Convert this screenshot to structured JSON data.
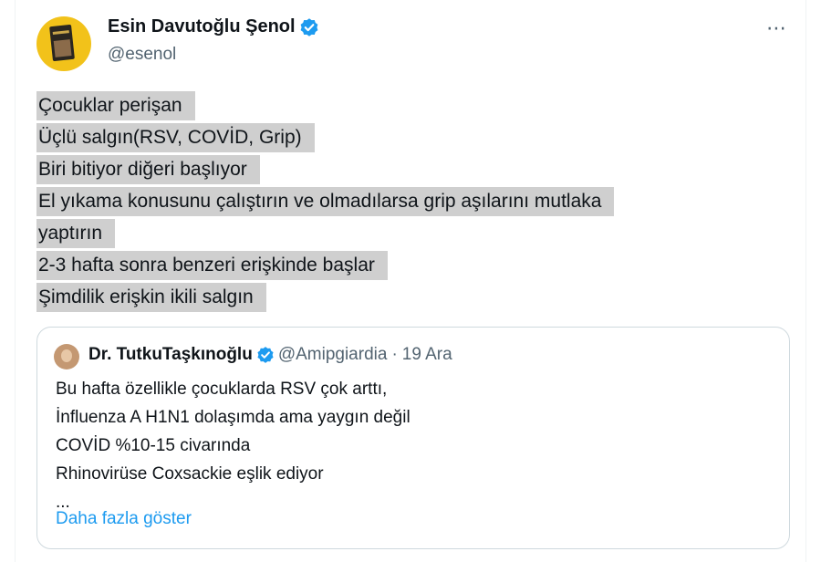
{
  "tweet": {
    "author_name": "Esin Davutoğlu Şenol",
    "author_handle": "@esenol",
    "more_icon": "⋯",
    "lines": [
      "Çocuklar perişan",
      "Üçlü salgın(RSV, COVİD, Grip)",
      "Biri bitiyor diğeri başlıyor",
      "El yıkama konusunu  çalıştırın ve olmadılarsa grip aşılarını mutlaka",
      "yaptırın",
      "2-3 hafta sonra benzeri erişkinde başlar",
      "Şimdilik erişkin ikili salgın"
    ]
  },
  "quote": {
    "author_name": "Dr. TutkuTaşkınoğlu",
    "author_handle": "@Amipgiardia",
    "separator": "·",
    "date": "19 Ara",
    "lines": [
      "Bu hafta özellikle çocuklarda RSV çok arttı,",
      "İnfluenza A H1N1 dolaşımda ama yaygın değil",
      "COVİD %10-15 civarında",
      "Rhinovirüse Coxsackie eşlik ediyor",
      "..."
    ],
    "show_more": "Daha fazla göster"
  },
  "colors": {
    "verified": "#1d9bf0",
    "highlight": "#cfcfcf",
    "link": "#1d9bf0",
    "secondary_text": "#536471"
  },
  "icons": {
    "verified": "verified-badge-icon",
    "more": "more-options-icon"
  }
}
